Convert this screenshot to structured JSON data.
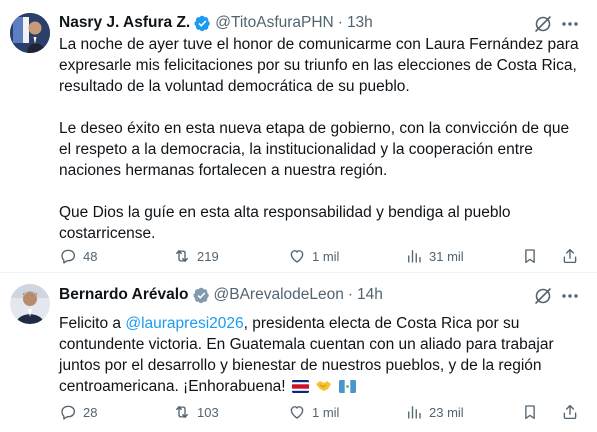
{
  "tweets": [
    {
      "author": "Nasry J. Asfura Z.",
      "handle": "@TitoAsfuraPHN",
      "separator": "·",
      "time": "13h",
      "paragraphs": [
        "La noche de ayer tuve el honor de comunicarme con Laura Fernández para expresarle mis felicitaciones por su triunfo en las elecciones de Costa Rica, resultado de la voluntad democrática de su pueblo.",
        "Le deseo éxito en esta nueva etapa de gobierno, con la convicción de que el respeto a la democracia, la institucionalidad y la cooperación entre naciones hermanas fortalecen a nuestra región.",
        "Que Dios la guíe en esta alta responsabilidad y bendiga al pueblo costarricense."
      ],
      "stats": {
        "replies": "48",
        "reposts": "219",
        "likes": "1 mil",
        "views": "31 mil"
      },
      "badge_color": "#1d9bf0"
    },
    {
      "author": "Bernardo Arévalo",
      "handle": "@BArevalodeLeon",
      "separator": "·",
      "time": "14h",
      "text_before": "Felicito a ",
      "mention": "@laurapresi2026",
      "text_after": ", presidenta electa de Costa Rica por su contundente victoria. En Guatemala cuentan con un aliado para trabajar juntos por el desarrollo y bienestar de nuestros pueblos, y de la región centroamericana. ¡Enhorabuena!",
      "emojis": [
        "flag-costa-rica-icon",
        "handshake-icon",
        "flag-guatemala-icon"
      ],
      "stats": {
        "replies": "28",
        "reposts": "103",
        "likes": "1 mil",
        "views": "23 mil"
      },
      "badge_color": "#829aab"
    }
  ],
  "colors": {
    "accent": "#1d9bf0",
    "muted": "#536471",
    "text": "#0f1419",
    "divider": "#eff3f4"
  }
}
